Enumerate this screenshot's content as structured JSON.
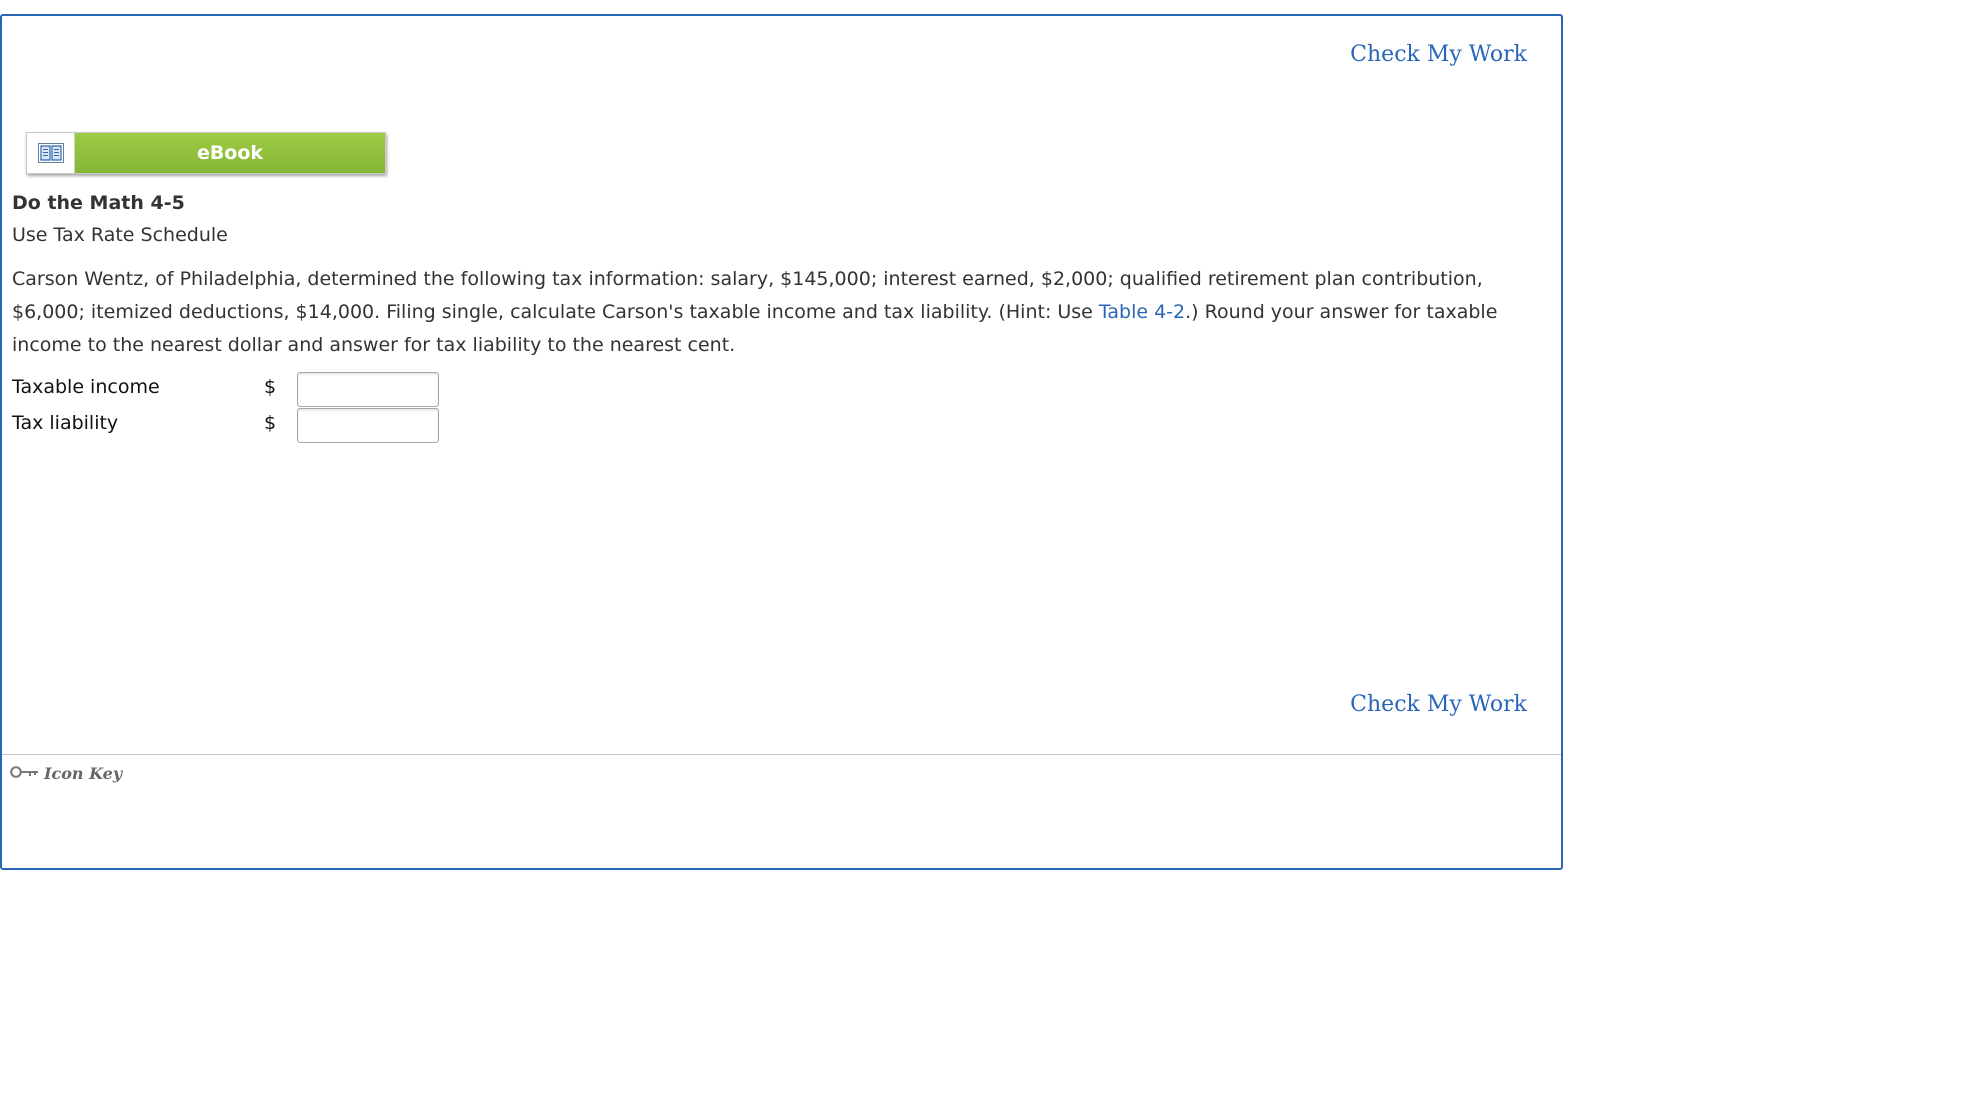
{
  "header": {
    "check_my_work_label": "Check My Work"
  },
  "ebook": {
    "label": "eBook",
    "icon": "book-icon"
  },
  "problem": {
    "title": "Do the Math 4-5",
    "subtitle": "Use Tax Rate Schedule",
    "text_before_link": "Carson Wentz, of Philadelphia, determined the following tax information: salary, $145,000; interest earned, $2,000; qualified retirement plan contribution, $6,000; itemized deductions, $14,000. Filing single, calculate Carson's taxable income and tax liability. (Hint: Use ",
    "link_text": "Table 4-2",
    "text_after_link": ".) Round your answer for taxable income to the nearest dollar and answer for tax liability to the nearest cent."
  },
  "answers": [
    {
      "label": "Taxable income",
      "currency": "$",
      "value": ""
    },
    {
      "label": "Tax liability",
      "currency": "$",
      "value": ""
    }
  ],
  "footer": {
    "check_my_work_label": "Check My Work",
    "icon_key_label": "Icon Key",
    "icon": "key-icon"
  },
  "colors": {
    "accent_blue": "#2a66b8",
    "ebook_green": "#8fbf3c"
  }
}
